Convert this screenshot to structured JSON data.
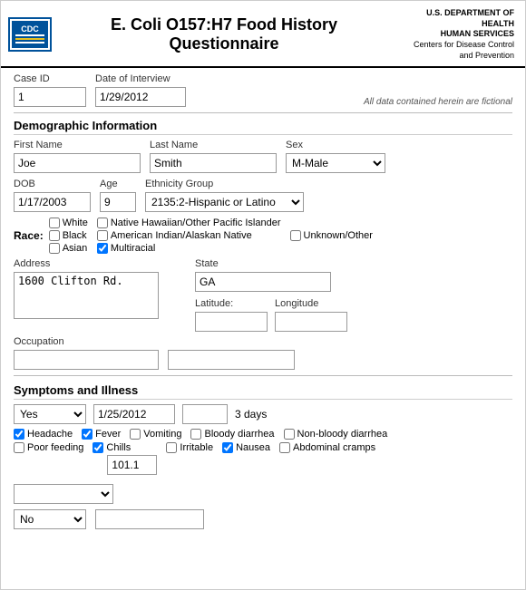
{
  "header": {
    "title": "E. Coli O157:H7 Food History Questionnaire",
    "dept_line1": "U.S. DEPARTMENT OF HEALTH",
    "dept_line2": "HUMAN SERVICES",
    "dept_line3": "Centers for Disease Control",
    "dept_line4": "and Prevention"
  },
  "case_id": {
    "label": "Case ID",
    "value": "1"
  },
  "date_of_interview": {
    "label": "Date of Interview",
    "value": "1/29/2012"
  },
  "fictional_note": "All data contained herein are fictional",
  "demographic": {
    "section_title": "Demographic Information",
    "first_name": {
      "label": "First Name",
      "value": "Joe"
    },
    "last_name": {
      "label": "Last Name",
      "value": "Smith"
    },
    "sex": {
      "label": "Sex",
      "value": "M-Male"
    },
    "dob": {
      "label": "DOB",
      "value": "1/17/2003"
    },
    "age": {
      "label": "Age",
      "value": "9"
    },
    "ethnicity": {
      "label": "Ethnicity Group",
      "value": "2135:2-Hispanic or Latino"
    },
    "race_label": "Race:",
    "race_options": [
      {
        "label": "White",
        "checked": false
      },
      {
        "label": "Black",
        "checked": false
      },
      {
        "label": "Asian",
        "checked": false
      },
      {
        "label": "Native Hawaiian/Other Pacific Islander",
        "checked": false
      },
      {
        "label": "American Indian/Alaskan Native",
        "checked": false
      },
      {
        "label": "Multiracial",
        "checked": true
      },
      {
        "label": "Unknown/Other",
        "checked": false
      }
    ],
    "address": {
      "label": "Address",
      "value": "1600 Clifton Rd."
    },
    "state": {
      "label": "State",
      "value": "GA"
    },
    "latitude_label": "Latitude:",
    "longitude_label": "Longitude",
    "occupation_label": "Occupation"
  },
  "symptoms": {
    "section_title": "Symptoms and Illness",
    "ill_select": "Yes",
    "ill_date": "1/25/2012",
    "duration": "3 days",
    "checks": [
      {
        "label": "Headache",
        "checked": true
      },
      {
        "label": "Fever",
        "checked": true
      },
      {
        "label": "Vomiting",
        "checked": false
      },
      {
        "label": "Bloody diarrhea",
        "checked": false
      },
      {
        "label": "Non-bloody diarrhea",
        "checked": false
      },
      {
        "label": "Poor feeding",
        "checked": false
      },
      {
        "label": "Chills",
        "checked": true
      },
      {
        "label": "Irritable",
        "checked": false
      },
      {
        "label": "Nausea",
        "checked": true
      },
      {
        "label": "Abdominal cramps",
        "checked": false
      }
    ],
    "temp_value": "101.1",
    "bottom_select": "",
    "bottom_select2": "No",
    "bottom_input": ""
  }
}
